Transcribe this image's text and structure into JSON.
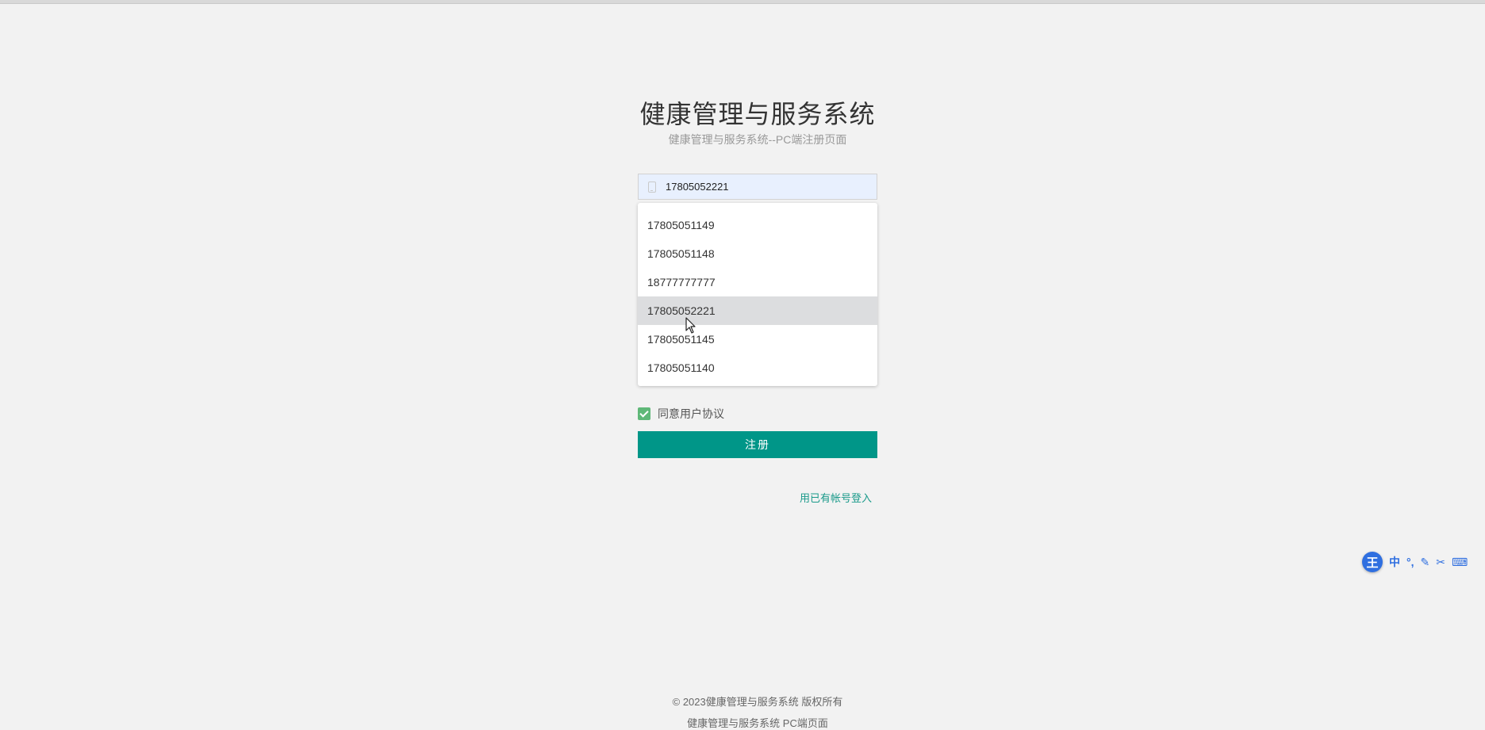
{
  "header": {
    "title": "健康管理与服务系统",
    "subtitle": "健康管理与服务系统--PC端注册页面"
  },
  "form": {
    "phone_value": "17805052221",
    "phone_icon": "mobile-phone-icon",
    "autocomplete": [
      "17805051149",
      "17805051148",
      "18777777777",
      "17805052221",
      "17805051145",
      "17805051140"
    ],
    "autocomplete_selected": "17805052221",
    "agree_label": "同意用户协议",
    "agree_checked": true,
    "register_label": "注册",
    "login_link": "用已有帐号登入"
  },
  "footer": {
    "copyright": "© 2023健康管理与服务系统 版权所有",
    "sub": "健康管理与服务系统 PC端页面"
  },
  "ime": {
    "logo": "王",
    "items": [
      "中",
      "°,",
      "✎",
      "✂",
      "⌨"
    ]
  },
  "colors": {
    "primary": "#009688",
    "checkbox": "#5fb878",
    "link": "#1a9a8a",
    "background": "#f2f2f2",
    "input_autofill": "#e8f0fe",
    "ime": "#2f6fe0"
  }
}
